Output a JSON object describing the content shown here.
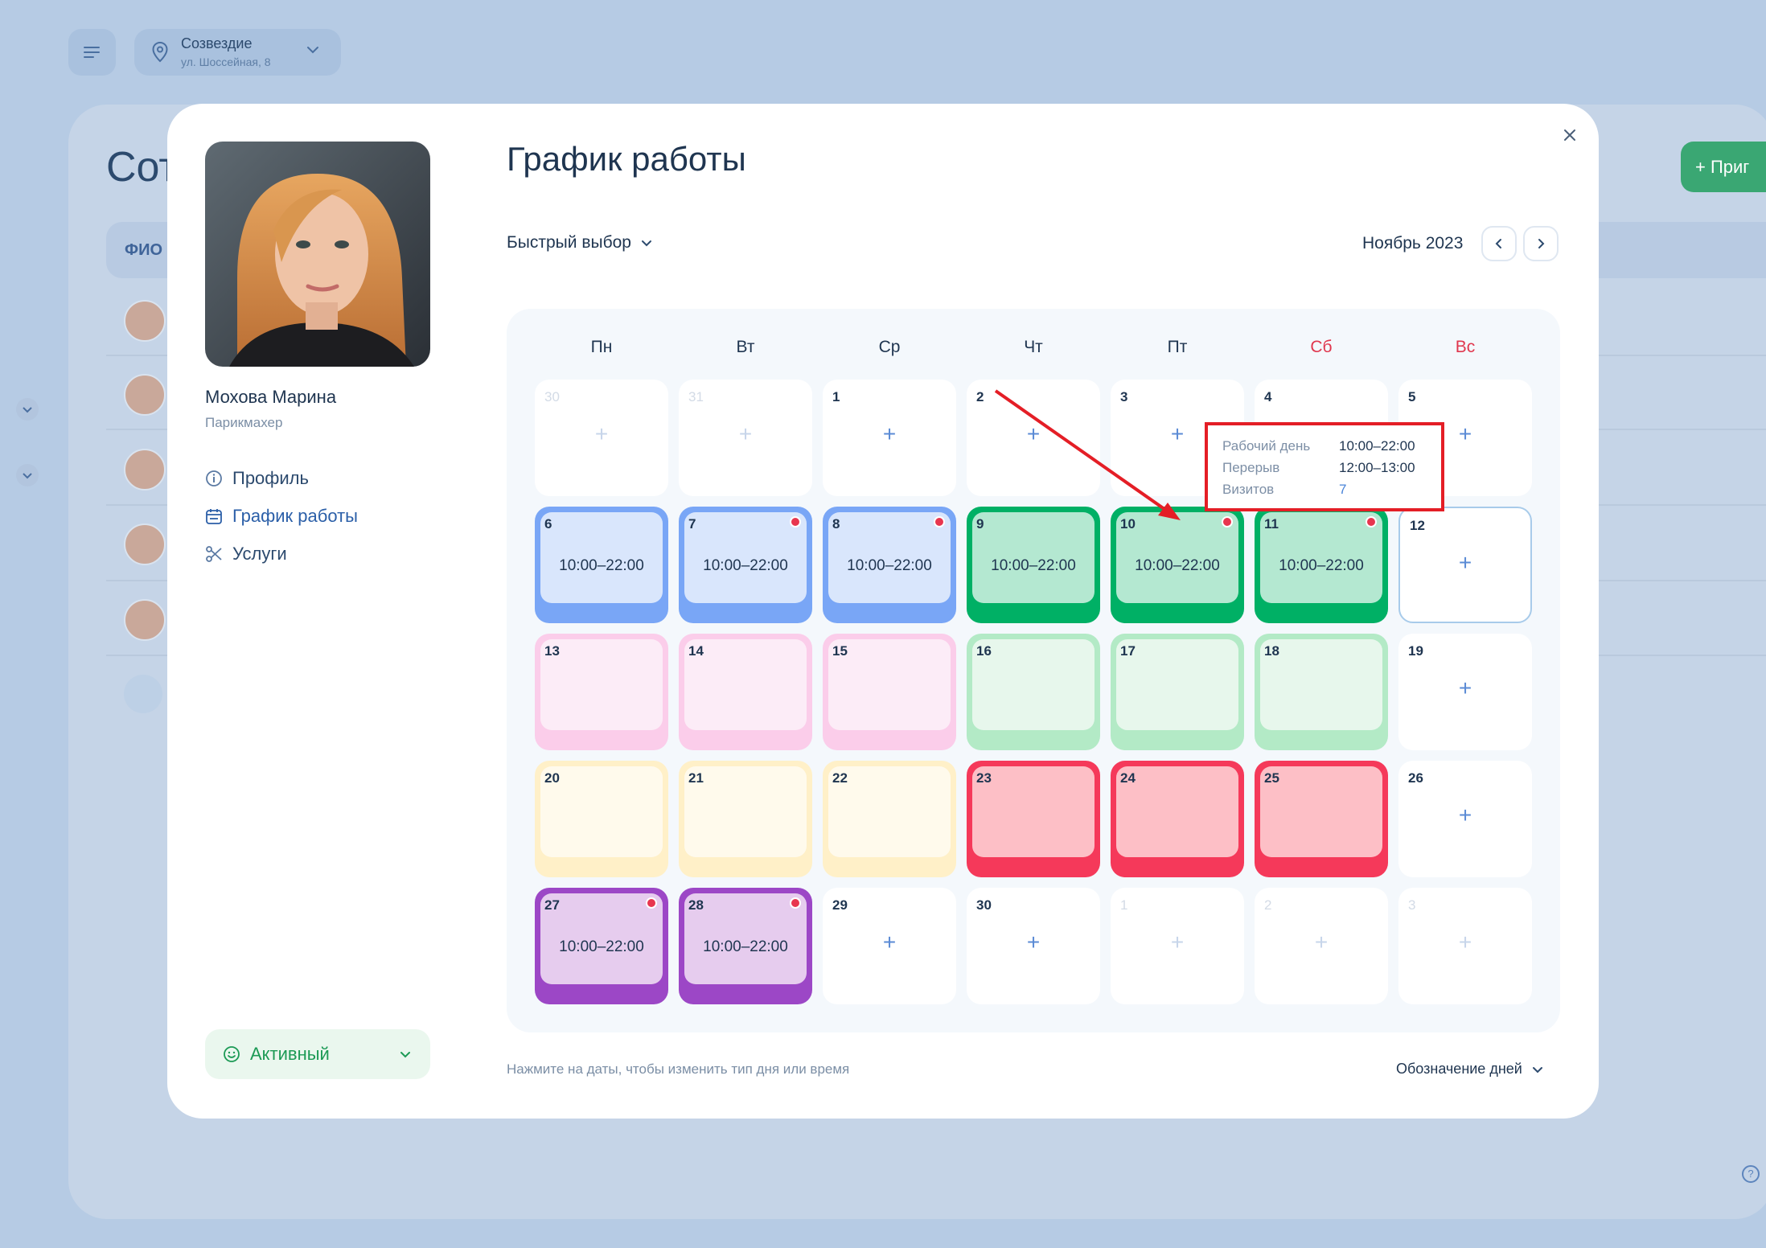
{
  "background": {
    "location": {
      "name": "Созвездие",
      "address": "ул. Шоссейная, 8"
    },
    "page_title_fragment": "Сот",
    "column_header_fragment": "ФИО",
    "invite_fragment": "+ Приг"
  },
  "modal": {
    "employee": {
      "name": "Мохова Марина",
      "role": "Парикмахер"
    },
    "nav": [
      {
        "label": "Профиль",
        "icon": "info-icon"
      },
      {
        "label": "График работы",
        "icon": "calendar-icon"
      },
      {
        "label": "Услуги",
        "icon": "scissors-icon"
      }
    ],
    "status": {
      "label": "Активный",
      "icon": "smile-icon"
    },
    "title": "График работы",
    "quick_select": "Быстрый выбор",
    "month": "Ноябрь 2023",
    "weekdays": [
      "Пн",
      "Вт",
      "Ср",
      "Чт",
      "Пт",
      "Сб",
      "Вс"
    ],
    "weeks": [
      [
        {
          "day": "30",
          "type": "empty",
          "dim": true
        },
        {
          "day": "31",
          "type": "empty",
          "dim": true
        },
        {
          "day": "1",
          "type": "empty"
        },
        {
          "day": "2",
          "type": "empty"
        },
        {
          "day": "3",
          "type": "empty"
        },
        {
          "day": "4",
          "type": "empty"
        },
        {
          "day": "5",
          "type": "empty"
        }
      ],
      [
        {
          "day": "6",
          "type": "blue",
          "time": "10:00–22:00"
        },
        {
          "day": "7",
          "type": "blue",
          "time": "10:00–22:00",
          "dot": true
        },
        {
          "day": "8",
          "type": "blue",
          "time": "10:00–22:00",
          "dot": true
        },
        {
          "day": "9",
          "type": "green",
          "time": "10:00–22:00"
        },
        {
          "day": "10",
          "type": "green",
          "time": "10:00–22:00",
          "dot": true
        },
        {
          "day": "11",
          "type": "green",
          "time": "10:00–22:00",
          "dot": true
        },
        {
          "day": "12",
          "type": "empty",
          "selected": true
        }
      ],
      [
        {
          "day": "13",
          "type": "pink"
        },
        {
          "day": "14",
          "type": "pink"
        },
        {
          "day": "15",
          "type": "pink"
        },
        {
          "day": "16",
          "type": "lgreen"
        },
        {
          "day": "17",
          "type": "lgreen"
        },
        {
          "day": "18",
          "type": "lgreen"
        },
        {
          "day": "19",
          "type": "empty"
        }
      ],
      [
        {
          "day": "20",
          "type": "yellow"
        },
        {
          "day": "21",
          "type": "yellow"
        },
        {
          "day": "22",
          "type": "yellow"
        },
        {
          "day": "23",
          "type": "red"
        },
        {
          "day": "24",
          "type": "red"
        },
        {
          "day": "25",
          "type": "red"
        },
        {
          "day": "26",
          "type": "empty"
        }
      ],
      [
        {
          "day": "27",
          "type": "purple",
          "time": "10:00–22:00",
          "dot": true
        },
        {
          "day": "28",
          "type": "purple",
          "time": "10:00–22:00",
          "dot": true
        },
        {
          "day": "29",
          "type": "empty"
        },
        {
          "day": "30",
          "type": "empty"
        },
        {
          "day": "1",
          "type": "empty",
          "dim": true
        },
        {
          "day": "2",
          "type": "empty",
          "dim": true
        },
        {
          "day": "3",
          "type": "empty",
          "dim": true
        }
      ]
    ],
    "tooltip": [
      {
        "label": "Рабочий день",
        "value": "10:00–22:00"
      },
      {
        "label": "Перерыв",
        "value": "12:00–13:00"
      },
      {
        "label": "Визитов",
        "value": "7"
      }
    ],
    "hint": "Нажмите на даты, чтобы изменить тип дня или время",
    "legend_toggle": "Обозначение дней"
  },
  "colors": {
    "annotation": "#e41e26",
    "active_status": "#1c9a55",
    "weekend": "#e0374e",
    "accent": "#2b5fa8"
  }
}
